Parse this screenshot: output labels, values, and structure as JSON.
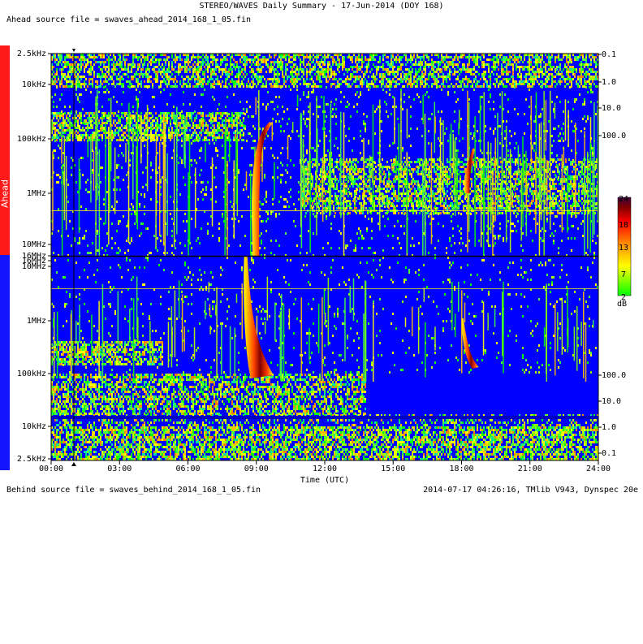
{
  "header": {
    "title": "STEREO/WAVES Daily Summary - 17-Jun-2014 (DOY 168)",
    "ahead_source": "Ahead source file = swaves_ahead_2014_168_1_05.fin",
    "behind_source": "Behind source file = swaves_behind_2014_168_1_05.fin",
    "footer": "2014-07-17 04:26:16, TMlib V943, Dynspec 20e"
  },
  "panels": {
    "ahead_label": "Ahead",
    "behind_label": "Behind"
  },
  "colors": {
    "background": "#0000ff",
    "ahead_bar": "#ff1a1a",
    "behind_bar": "#1414ff"
  },
  "chart_data": {
    "type": "heatmap",
    "xlabel": "Time (UTC)",
    "x_ticks": [
      "00:00",
      "03:00",
      "06:00",
      "09:00",
      "12:00",
      "15:00",
      "18:00",
      "21:00",
      "24:00"
    ],
    "x_range_hours": [
      0,
      24
    ],
    "colorbar": {
      "ticks": [
        "24",
        "18",
        "13",
        "7",
        "2"
      ],
      "unit": "dB",
      "range": [
        2,
        24
      ],
      "colors": [
        "#00ff00",
        "#ffff00",
        "#ff8000",
        "#ff0000",
        "#800000",
        "#400040"
      ]
    },
    "ahead": {
      "freq_ticks": [
        "2.5kHz",
        "10kHz",
        "100kHz",
        "1MHz",
        "10MHz",
        "16MHz"
      ],
      "right_ticks": [
        "0.1",
        "1.0",
        "10.0",
        "100.0"
      ],
      "features": [
        {
          "name": "type III burst",
          "start_utc": "08:45",
          "end_utc": "09:35",
          "freq_range": [
            "100kHz",
            "16MHz"
          ]
        },
        {
          "name": "type III burst",
          "start_utc": "18:05",
          "end_utc": "18:30",
          "freq_range": [
            "300kHz",
            "1MHz"
          ]
        }
      ]
    },
    "behind": {
      "freq_ticks": [
        "16MHz",
        "10MHz",
        "1MHz",
        "100kHz",
        "10kHz",
        "2.5kHz"
      ],
      "right_ticks": [
        "100.0",
        "10.0",
        "1.0",
        "0.1"
      ],
      "features": [
        {
          "name": "type III burst",
          "start_utc": "08:45",
          "end_utc": "09:45",
          "freq_range": [
            "100kHz",
            "16MHz"
          ]
        },
        {
          "name": "type III burst",
          "start_utc": "18:05",
          "end_utc": "18:45",
          "freq_range": [
            "100kHz",
            "1MHz"
          ]
        }
      ]
    }
  }
}
